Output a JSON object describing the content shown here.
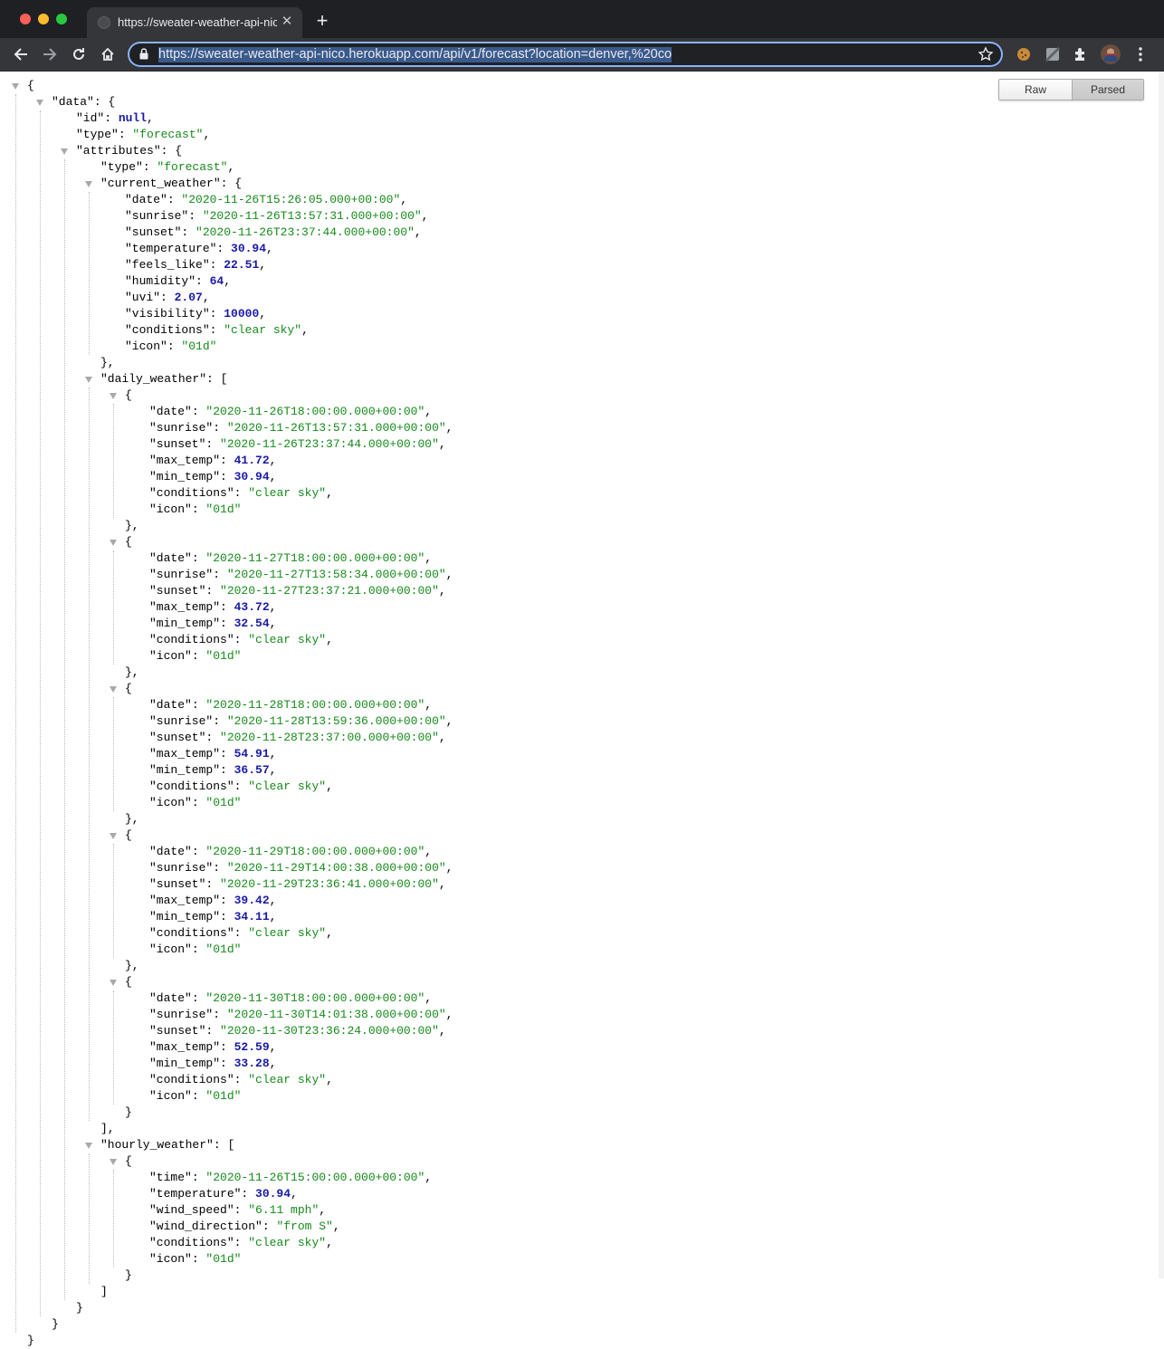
{
  "browser": {
    "tab_title": "https://sweater-weather-api-nico",
    "tab_close_glyph": "✕",
    "new_tab_glyph": "+",
    "url": "https://sweater-weather-api-nico.herokuapp.com/api/v1/forecast?location=denver,%20co",
    "icons": [
      "back-icon",
      "forward-icon",
      "reload-icon",
      "home-icon",
      "lock-icon",
      "bookmark-star-icon",
      "cookie-extension-icon",
      "extension-icon",
      "puzzle-extensions-icon",
      "profile-avatar",
      "menu-kebab-icon"
    ]
  },
  "viewer": {
    "raw_label": "Raw",
    "parsed_label": "Parsed",
    "active_view": "Parsed"
  },
  "json": {
    "data": {
      "id": null,
      "type": "forecast",
      "attributes": {
        "type": "forecast",
        "current_weather": {
          "date": "2020-11-26T15:26:05.000+00:00",
          "sunrise": "2020-11-26T13:57:31.000+00:00",
          "sunset": "2020-11-26T23:37:44.000+00:00",
          "temperature": 30.94,
          "feels_like": 22.51,
          "humidity": 64,
          "uvi": 2.07,
          "visibility": 10000,
          "conditions": "clear sky",
          "icon": "01d"
        },
        "daily_weather": [
          {
            "date": "2020-11-26T18:00:00.000+00:00",
            "sunrise": "2020-11-26T13:57:31.000+00:00",
            "sunset": "2020-11-26T23:37:44.000+00:00",
            "max_temp": 41.72,
            "min_temp": 30.94,
            "conditions": "clear sky",
            "icon": "01d"
          },
          {
            "date": "2020-11-27T18:00:00.000+00:00",
            "sunrise": "2020-11-27T13:58:34.000+00:00",
            "sunset": "2020-11-27T23:37:21.000+00:00",
            "max_temp": 43.72,
            "min_temp": 32.54,
            "conditions": "clear sky",
            "icon": "01d"
          },
          {
            "date": "2020-11-28T18:00:00.000+00:00",
            "sunrise": "2020-11-28T13:59:36.000+00:00",
            "sunset": "2020-11-28T23:37:00.000+00:00",
            "max_temp": 54.91,
            "min_temp": 36.57,
            "conditions": "clear sky",
            "icon": "01d"
          },
          {
            "date": "2020-11-29T18:00:00.000+00:00",
            "sunrise": "2020-11-29T14:00:38.000+00:00",
            "sunset": "2020-11-29T23:36:41.000+00:00",
            "max_temp": 39.42,
            "min_temp": 34.11,
            "conditions": "clear sky",
            "icon": "01d"
          },
          {
            "date": "2020-11-30T18:00:00.000+00:00",
            "sunrise": "2020-11-30T14:01:38.000+00:00",
            "sunset": "2020-11-30T23:36:24.000+00:00",
            "max_temp": 52.59,
            "min_temp": 33.28,
            "conditions": "clear sky",
            "icon": "01d"
          }
        ],
        "hourly_weather": [
          {
            "time": "2020-11-26T15:00:00.000+00:00",
            "temperature": 30.94,
            "wind_speed": "6.11 mph",
            "wind_direction": "from S",
            "conditions": "clear sky",
            "icon": "01d"
          }
        ]
      }
    }
  }
}
